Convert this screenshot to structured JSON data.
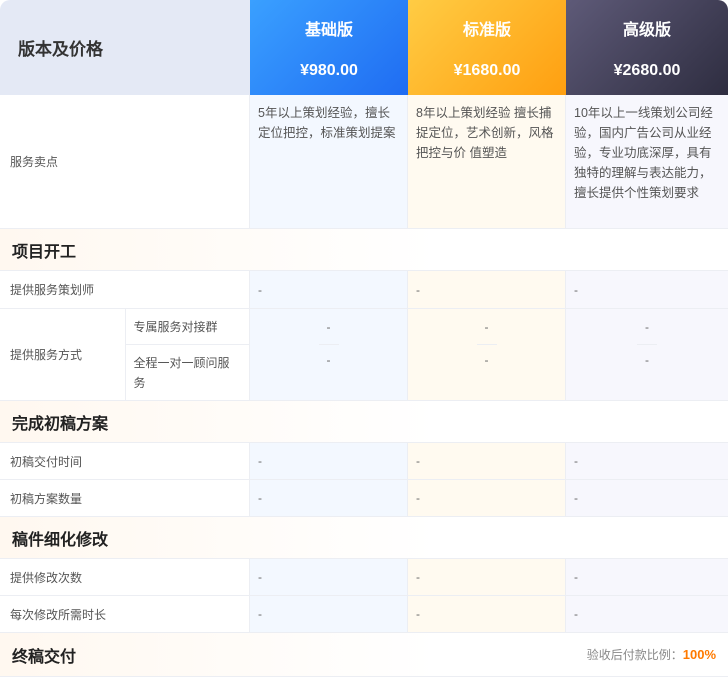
{
  "header": {
    "label": "版本及价格",
    "plans": [
      {
        "name": "基础版",
        "price": "¥980.00"
      },
      {
        "name": "标准版",
        "price": "¥1680.00"
      },
      {
        "name": "高级版",
        "price": "¥2680.00"
      }
    ]
  },
  "selling": {
    "label": "服务卖点",
    "values": [
      "5年以上策划经验，擅长定位把控，标准策划提案",
      "8年以上策划经验 擅长捕捉定位，艺术创新，风格把控与价 值塑造",
      "10年以上一线策划公司经验，国内广告公司从业经验，专业功底深厚，具有独特的理解与表达能力，擅长提供个性策划要求"
    ]
  },
  "sections": [
    {
      "title": "项目开工",
      "rows": [
        {
          "label": "提供服务策划师",
          "values": [
            "-",
            "-",
            "-"
          ]
        }
      ],
      "service_method": {
        "label": "提供服务方式",
        "sub": [
          {
            "label": "专属服务对接群",
            "values": [
              "-",
              "-",
              "-"
            ]
          },
          {
            "label": "全程一对一顾问服务",
            "values": [
              "-",
              "-",
              "-"
            ]
          }
        ]
      }
    },
    {
      "title": "完成初稿方案",
      "rows": [
        {
          "label": "初稿交付时间",
          "values": [
            "-",
            "-",
            "-"
          ]
        },
        {
          "label": "初稿方案数量",
          "values": [
            "-",
            "-",
            "-"
          ]
        }
      ]
    },
    {
      "title": "稿件细化修改",
      "rows": [
        {
          "label": "提供修改次数",
          "values": [
            "-",
            "-",
            "-"
          ]
        },
        {
          "label": "每次修改所需时长",
          "values": [
            "-",
            "-",
            "-"
          ]
        }
      ]
    },
    {
      "title": "终稿交付",
      "note_label": "验收后付款比例：",
      "note_value": "100%"
    }
  ]
}
